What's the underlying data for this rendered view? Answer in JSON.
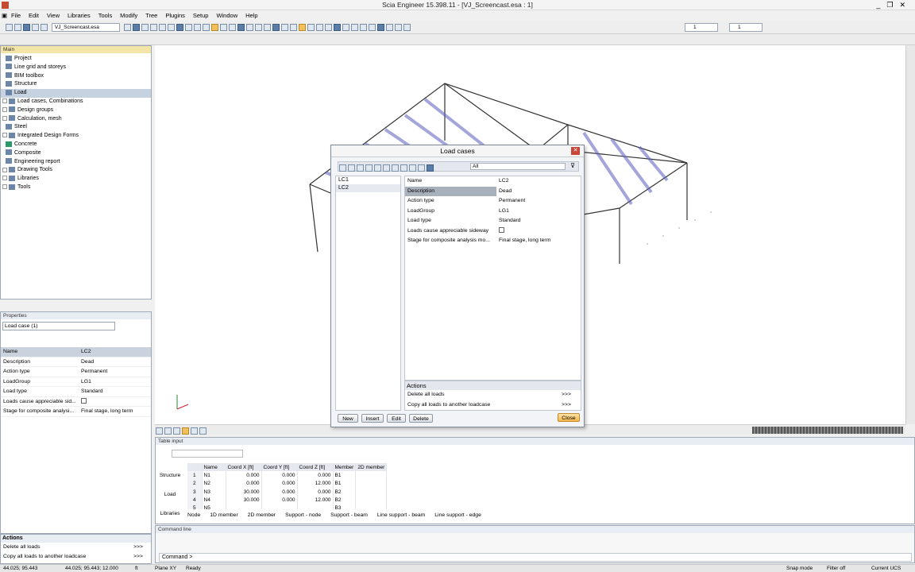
{
  "window": {
    "title": "Scia Engineer 15.398.11 - [VJ_Screencast.esa : 1]"
  },
  "menu": [
    "File",
    "Edit",
    "View",
    "Libraries",
    "Tools",
    "Modify",
    "Tree",
    "Plugins",
    "Setup",
    "Window",
    "Help"
  ],
  "toolbar": {
    "file_name": "VJ_Screencast.esa",
    "page_spin_1": "1",
    "page_spin_2": "1"
  },
  "main_panel": {
    "title": "Main",
    "tree": [
      "Project",
      "Line grid and storeys",
      "BIM toolbox",
      "Structure",
      "Load",
      "Load cases, Combinations",
      "Design groups",
      "Calculation, mesh",
      "Steel",
      "Integrated Design Forms",
      "Concrete",
      "Composite",
      "Engineering report",
      "Drawing Tools",
      "Libraries",
      "Tools"
    ],
    "selected": "Load"
  },
  "properties": {
    "title": "Properties",
    "selector": "Load case (1)",
    "rows": [
      {
        "k": "Name",
        "v": "LC2"
      },
      {
        "k": "Description",
        "v": "Dead"
      },
      {
        "k": "Action type",
        "v": "Permanent"
      },
      {
        "k": "LoadGroup",
        "v": "LG1"
      },
      {
        "k": "Load type",
        "v": "Standard"
      },
      {
        "k": "Loads cause appreciable sid...",
        "v": ""
      },
      {
        "k": "Stage for composite analysi...",
        "v": "Final stage, long term"
      }
    ]
  },
  "actions_panel": {
    "title": "Actions",
    "items": [
      {
        "label": "Delete all loads",
        "arrow": ">>>"
      },
      {
        "label": "Copy all loads to another loadcase",
        "arrow": ">>>"
      }
    ]
  },
  "dialog": {
    "title": "Load cases",
    "filter": "All",
    "list": [
      "LC1",
      "LC2"
    ],
    "props": [
      {
        "k": "Name",
        "v": "LC2"
      },
      {
        "k": "Description",
        "v": "Dead"
      },
      {
        "k": "Action type",
        "v": "Permanent"
      },
      {
        "k": "LoadGroup",
        "v": "LG1"
      },
      {
        "k": "Load type",
        "v": "Standard"
      },
      {
        "k": "Loads cause appreciable sideway",
        "v": ""
      },
      {
        "k": "Stage for composite analysis mo...",
        "v": "Final stage, long term"
      }
    ],
    "actions_title": "Actions",
    "actions": [
      {
        "label": "Delete all loads",
        "arrow": ">>>"
      },
      {
        "label": "Copy all loads to another loadcase",
        "arrow": ">>>"
      }
    ],
    "buttons": {
      "new": "New",
      "insert": "Insert",
      "edit": "Edit",
      "delete": "Delete",
      "close": "Close"
    }
  },
  "table_input": {
    "title": "Table input",
    "side": [
      "Structure",
      "Load",
      "Libraries"
    ],
    "columns": [
      "Name",
      "Coord X [ft]",
      "Coord Y [ft]",
      "Coord Z [ft]",
      "Member",
      "2D member"
    ],
    "rows": [
      {
        "n": "1",
        "name": "N1",
        "x": "0.000",
        "y": "0.000",
        "z": "0.000",
        "m": "B1"
      },
      {
        "n": "2",
        "name": "N2",
        "x": "0.000",
        "y": "0.000",
        "z": "12.000",
        "m": "B1"
      },
      {
        "n": "3",
        "name": "N3",
        "x": "30.000",
        "y": "0.000",
        "z": "0.000",
        "m": "B2"
      },
      {
        "n": "4",
        "name": "N4",
        "x": "30.000",
        "y": "0.000",
        "z": "12.000",
        "m": "B2"
      },
      {
        "n": "5",
        "name": "N5",
        "x": "",
        "y": "",
        "z": "",
        "m": "B3"
      }
    ],
    "tabs": [
      "Node",
      "1D member",
      "2D member",
      "Support - node",
      "Support - beam",
      "Line support - beam",
      "Line support - edge"
    ]
  },
  "command_line": {
    "title": "Command line",
    "prompt": "Command >"
  },
  "status": {
    "coords1": "44.025; 95.443",
    "coords2": "44.025; 95.443; 12.000",
    "unit": "ft",
    "plane": "Plane XY",
    "state": "Ready",
    "snap": "Snap mode",
    "filter": "Filter off",
    "ucs": "Current UCS"
  }
}
